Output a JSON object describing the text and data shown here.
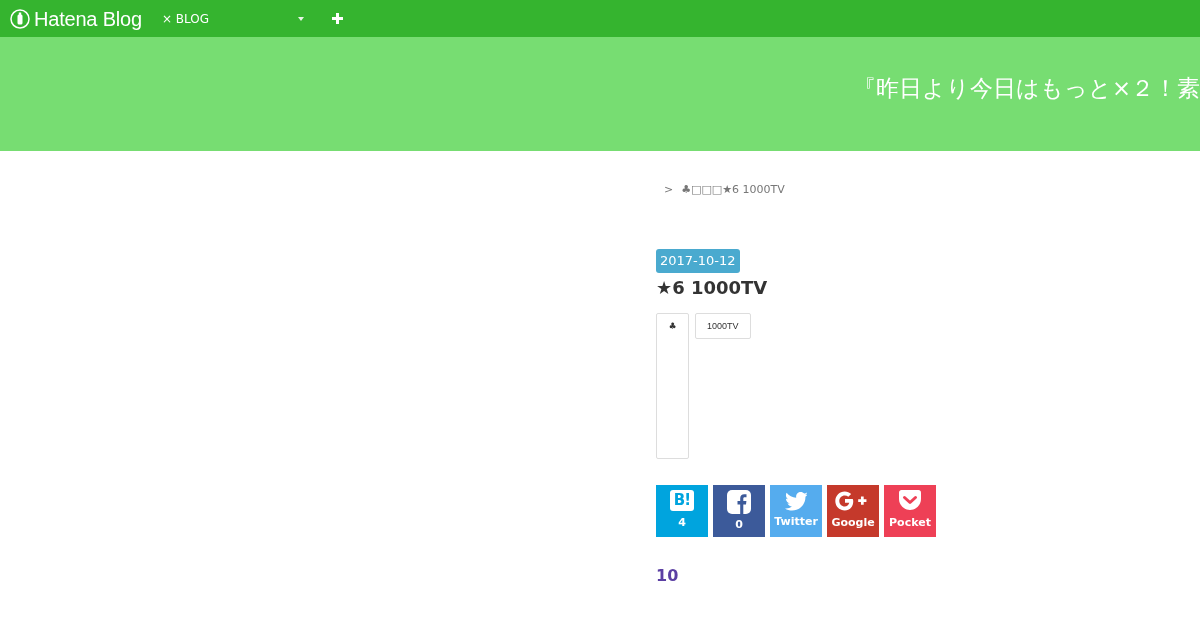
{
  "topbar": {
    "logo": "Hatena Blog",
    "blog_menu": "× BLOG"
  },
  "header": {
    "title": "『昨日より今日はもっと×２！素"
  },
  "breadcrumb": {
    "separator": ">",
    "text": "♣□□□★6 1000TV"
  },
  "entry": {
    "date": "2017-10-12",
    "title": "★6 1000TV",
    "embed_text": "♣",
    "categories": [
      "1000TV"
    ]
  },
  "share_buttons": [
    {
      "kind": "hatena",
      "icon_text": "B!",
      "label": "4"
    },
    {
      "kind": "facebook",
      "label": "0"
    },
    {
      "kind": "twitter",
      "label": "Twitter"
    },
    {
      "kind": "google",
      "label": "Google"
    },
    {
      "kind": "pocket",
      "label": "Pocket"
    }
  ],
  "star_count": "10"
}
